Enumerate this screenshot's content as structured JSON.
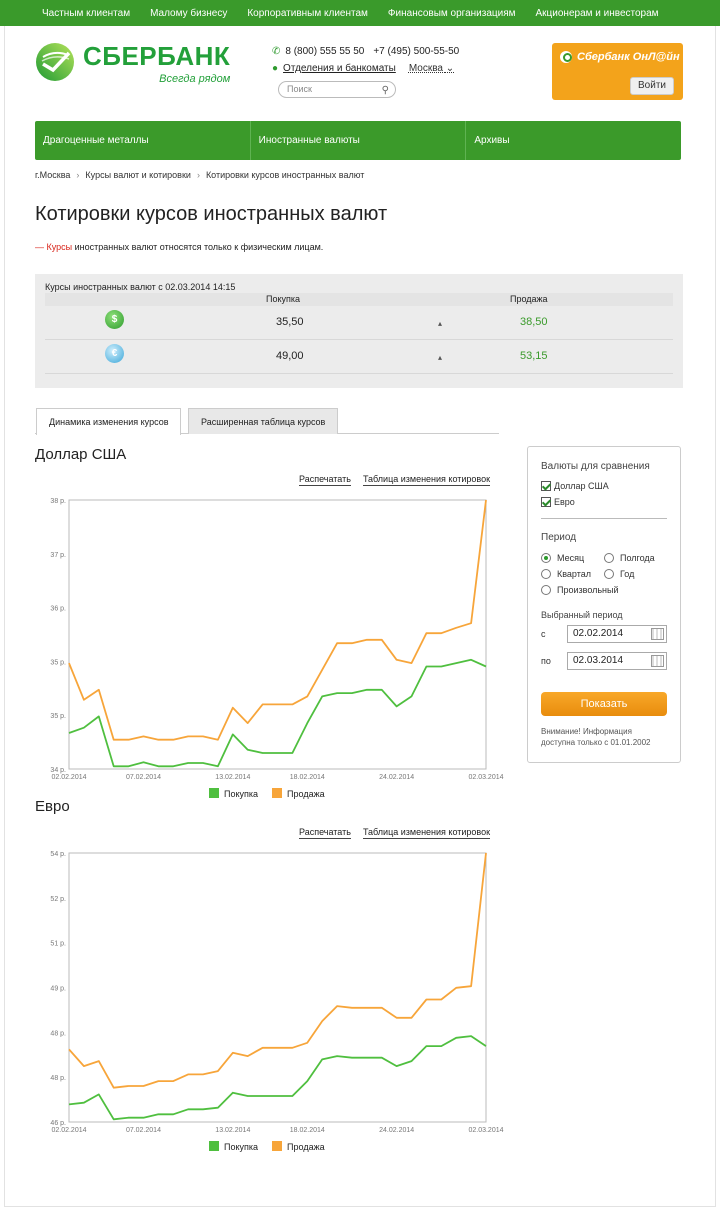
{
  "topnav": [
    "Частным клиентам",
    "Малому бизнесу",
    "Корпоративным клиентам",
    "Финансовым организациям",
    "Акционерам и инвесторам"
  ],
  "logo": {
    "name": "СБЕРБАНК",
    "tagline": "Всегда рядом"
  },
  "contacts": {
    "phone1": "8 (800) 555 55 50",
    "phone2": "+7 (495) 500-55-50",
    "branches": "Отделения и банкоматы",
    "city": "Москва"
  },
  "search": {
    "placeholder": "Поиск"
  },
  "online": {
    "title": "Сбербанк ОнЛ@йн",
    "login": "Войти"
  },
  "mainnav": [
    "Драгоценные металлы",
    "Иностранные валюты",
    "Архивы"
  ],
  "breadcrumb": [
    "г.Москва",
    "Курсы валют и котировки",
    "Котировки курсов иностранных валют"
  ],
  "page": {
    "title": "Котировки курсов иностранных валют",
    "note_dash": "—",
    "note_link": "Курсы",
    "note_rest": " иностранных валют относятся только к физическим лицам."
  },
  "rates": {
    "caption": "Курсы иностранных валют с 02.03.2014 14:15",
    "buy_header": "Покупка",
    "sell_header": "Продажа",
    "rows": [
      {
        "currency_icon": "dollar-coin-icon",
        "symbol": "$",
        "buy": "35,50",
        "sell": "38,50"
      },
      {
        "currency_icon": "euro-coin-icon",
        "symbol": "€",
        "buy": "49,00",
        "sell": "53,15"
      }
    ]
  },
  "tabs": [
    "Динамика изменения курсов",
    "Расширенная таблица курсов"
  ],
  "actions": {
    "print": "Распечатать",
    "table": "Таблица изменения котировок"
  },
  "legend": {
    "buy": "Покупка",
    "sell": "Продажа"
  },
  "colors": {
    "buy": "#4fbf3f",
    "sell": "#f7a53a",
    "brand": "#3a9a2b",
    "button": "#f39a1c"
  },
  "chart_data": [
    {
      "type": "line",
      "title": "Доллар США",
      "x_ticks": [
        "02.02.2014",
        "07.02.2014",
        "13.02.2014",
        "18.02.2014",
        "24.02.2014",
        "02.03.2014"
      ],
      "y_ticks": [
        "34 р.",
        "35 р.",
        "35 р.",
        "36 р.",
        "37 р.",
        "38 р."
      ],
      "series": [
        {
          "name": "Покупка",
          "values": [
            34.5,
            34.58,
            34.75,
            34.0,
            34.0,
            34.06,
            34.0,
            34.0,
            34.05,
            34.05,
            34.0,
            34.48,
            34.25,
            34.2,
            34.2,
            34.2,
            34.65,
            35.05,
            35.1,
            35.1,
            35.15,
            35.15,
            34.9,
            35.05,
            35.5,
            35.5,
            35.55,
            35.6,
            35.5
          ]
        },
        {
          "name": "Продажа",
          "values": [
            35.55,
            35.0,
            35.15,
            34.4,
            34.4,
            34.45,
            34.4,
            34.4,
            34.45,
            34.45,
            34.4,
            34.88,
            34.65,
            34.93,
            34.93,
            34.93,
            35.05,
            35.45,
            35.85,
            35.85,
            35.9,
            35.9,
            35.6,
            35.55,
            36.0,
            36.0,
            36.08,
            36.15,
            38.0
          ]
        }
      ]
    },
    {
      "type": "line",
      "title": "Евро",
      "x_ticks": [
        "02.02.2014",
        "07.02.2014",
        "13.02.2014",
        "18.02.2014",
        "24.02.2014",
        "02.03.2014"
      ],
      "y_ticks": [
        "46 р.",
        "48 р.",
        "48 р.",
        "49 р.",
        "51 р.",
        "52 р.",
        "54 р."
      ],
      "series": [
        {
          "name": "Покупка",
          "values": [
            46.45,
            46.5,
            46.75,
            46.0,
            46.05,
            46.05,
            46.15,
            46.15,
            46.3,
            46.3,
            46.35,
            46.8,
            46.7,
            46.7,
            46.7,
            46.7,
            47.15,
            47.8,
            47.9,
            47.85,
            47.85,
            47.85,
            47.6,
            47.75,
            48.2,
            48.2,
            48.45,
            48.5,
            48.2
          ]
        },
        {
          "name": "Продажа",
          "values": [
            48.1,
            47.6,
            47.75,
            46.95,
            47.0,
            47.0,
            47.15,
            47.15,
            47.35,
            47.35,
            47.45,
            48.0,
            47.9,
            48.15,
            48.15,
            48.15,
            48.3,
            48.95,
            49.4,
            49.35,
            49.35,
            49.35,
            49.05,
            49.05,
            49.6,
            49.6,
            49.95,
            50.0,
            54.0
          ]
        }
      ]
    }
  ],
  "panel": {
    "compare_title": "Валюты для сравнения",
    "cur1": "Доллар США",
    "cur2": "Евро",
    "period_title": "Период",
    "periods": [
      "Месяц",
      "Полгода",
      "Квартал",
      "Год",
      "Произвольный"
    ],
    "selected_title": "Выбранный период",
    "from_label": "с",
    "to_label": "по",
    "from_value": "02.02.2014",
    "to_value": "02.03.2014",
    "show": "Показать",
    "warning": "Внимание! Информация доступна только с 01.01.2002"
  }
}
